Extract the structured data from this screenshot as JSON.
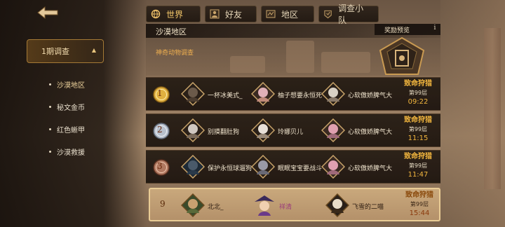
{
  "tabs": [
    {
      "label": "世界",
      "icon": "globe-icon",
      "active": true
    },
    {
      "label": "好友",
      "icon": "friends-icon",
      "active": false
    },
    {
      "label": "地区",
      "icon": "region-icon",
      "active": false
    },
    {
      "label": "调查小队",
      "icon": "squad-icon",
      "active": false
    }
  ],
  "sidebar": {
    "header": "1期调查",
    "items": [
      {
        "label": "沙漠地区"
      },
      {
        "label": "秘文金币"
      },
      {
        "label": "红色蜥甲"
      },
      {
        "label": "沙漠救援"
      }
    ]
  },
  "banner": {
    "title": "沙漠地区",
    "subtitle": "神奇动物调查",
    "reward_label": "奖励预览",
    "info": "i"
  },
  "rows": [
    {
      "rank": "1",
      "medal": "gold",
      "players": [
        {
          "name": "一杯冰美式_"
        },
        {
          "name": "柚子想要永恒死"
        },
        {
          "name": "心软傲娇脾气大"
        }
      ],
      "result": "致命狩猎",
      "floor": "第99层",
      "time": "09:22"
    },
    {
      "rank": "2",
      "medal": "silver",
      "players": [
        {
          "name": "别摸翻肚狗"
        },
        {
          "name": "玲娜贝儿"
        },
        {
          "name": "心软傲娇脾气大"
        }
      ],
      "result": "致命狩猎",
      "floor": "第99层",
      "time": "11:15"
    },
    {
      "rank": "3",
      "medal": "bronze",
      "players": [
        {
          "name": "保护永恒球遛狗"
        },
        {
          "name": "眠眠宝宝要战斗"
        },
        {
          "name": "心软傲娇脾气大"
        }
      ],
      "result": "致命狩猎",
      "floor": "第99层",
      "time": "11:47"
    }
  ],
  "mine": {
    "rank": "9",
    "players": [
      {
        "name": "北北_"
      },
      {
        "name": "祥清"
      },
      {
        "name": "飞雪的二喵"
      }
    ],
    "result": "致命狩猎",
    "floor": "第99层",
    "time": "15:44"
  },
  "colors": {
    "accent": "#f2b63e",
    "mine_bg": "#c9a87c",
    "row_bg": "#261c14"
  }
}
